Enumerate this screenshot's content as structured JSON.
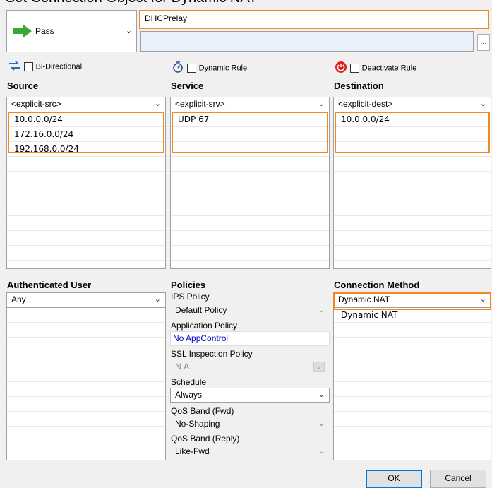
{
  "top_cut_text": "Set Connection Object for Dynamic NAT",
  "action": {
    "label": "Pass"
  },
  "rule_name": {
    "value": "DHCPrelay"
  },
  "description": {
    "value": ""
  },
  "ellipsis_label": "...",
  "options": {
    "bidirectional": "Bi-Directional",
    "dynamic_rule": "Dynamic Rule",
    "deactivate_rule": "Deactivate Rule"
  },
  "source": {
    "title": "Source",
    "selected": "<explicit-src>",
    "items": [
      "10.0.0.0/24",
      "172.16.0.0/24",
      "192.168.0.0/24"
    ]
  },
  "service": {
    "title": "Service",
    "selected": "<explicit-srv>",
    "items": [
      "UDP 67"
    ]
  },
  "destination": {
    "title": "Destination",
    "selected": "<explicit-dest>",
    "items": [
      "10.0.0.0/24"
    ]
  },
  "auth_user": {
    "title": "Authenticated User",
    "selected": "Any"
  },
  "policies": {
    "title": "Policies",
    "ips_label": "IPS Policy",
    "ips_value": "Default Policy",
    "app_label": "Application Policy",
    "app_value": "No AppControl",
    "ssl_label": "SSL Inspection Policy",
    "ssl_value": "N.A.",
    "schedule_label": "Schedule",
    "schedule_value": "Always",
    "qos_fwd_label": "QoS Band (Fwd)",
    "qos_fwd_value": "No-Shaping",
    "qos_reply_label": "QoS Band (Reply)",
    "qos_reply_value": "Like-Fwd"
  },
  "connection": {
    "title": "Connection Method",
    "selected": "Dynamic NAT",
    "items": [
      "Dynamic NAT"
    ]
  },
  "buttons": {
    "ok": "OK",
    "cancel": "Cancel"
  },
  "colors": {
    "accent": "#f08a1e",
    "link": "#0000cc",
    "pass_arrow": "#3aa835",
    "deactivate": "#e0201b"
  }
}
